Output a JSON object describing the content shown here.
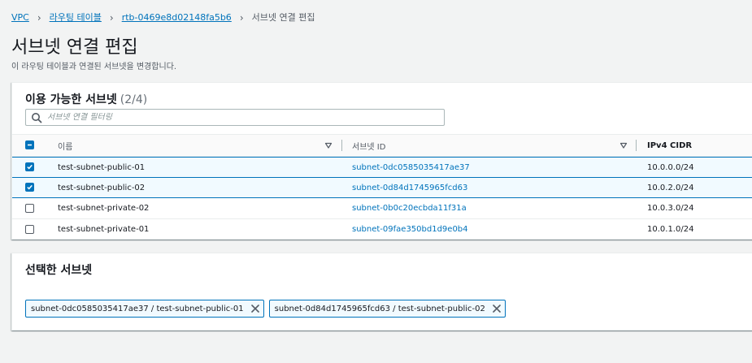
{
  "breadcrumb": {
    "items": [
      "VPC",
      "라우팅 테이블",
      "rtb-0469e8d02148fa5b6"
    ],
    "current": "서브넷 연결 편집"
  },
  "page": {
    "title": "서브넷 연결 편집",
    "description": "이 라우팅 테이블과 연결된 서브넷을 변경합니다."
  },
  "available": {
    "title": "이용 가능한 서브넷",
    "count": "(2/4)",
    "search_placeholder": "서브넷 연결 필터링",
    "columns": {
      "name": "이름",
      "id": "서브넷 ID",
      "cidr": "IPv4 CIDR"
    },
    "rows": [
      {
        "name": "test-subnet-public-01",
        "id": "subnet-0dc0585035417ae37",
        "cidr": "10.0.0.0/24",
        "checked": true
      },
      {
        "name": "test-subnet-public-02",
        "id": "subnet-0d84d1745965fcd63",
        "cidr": "10.0.2.0/24",
        "checked": true
      },
      {
        "name": "test-subnet-private-02",
        "id": "subnet-0b0c20ecbda11f31a",
        "cidr": "10.0.3.0/24",
        "checked": false
      },
      {
        "name": "test-subnet-private-01",
        "id": "subnet-09fae350bd1d9e0b4",
        "cidr": "10.0.1.0/24",
        "checked": false
      }
    ]
  },
  "selected": {
    "title": "선택한 서브넷",
    "tokens": [
      "subnet-0dc0585035417ae37 / test-subnet-public-01",
      "subnet-0d84d1745965fcd63 / test-subnet-public-02"
    ]
  },
  "colors": {
    "link": "#0073bb",
    "selected_bg": "#f1faff",
    "border": "#eaeded"
  }
}
